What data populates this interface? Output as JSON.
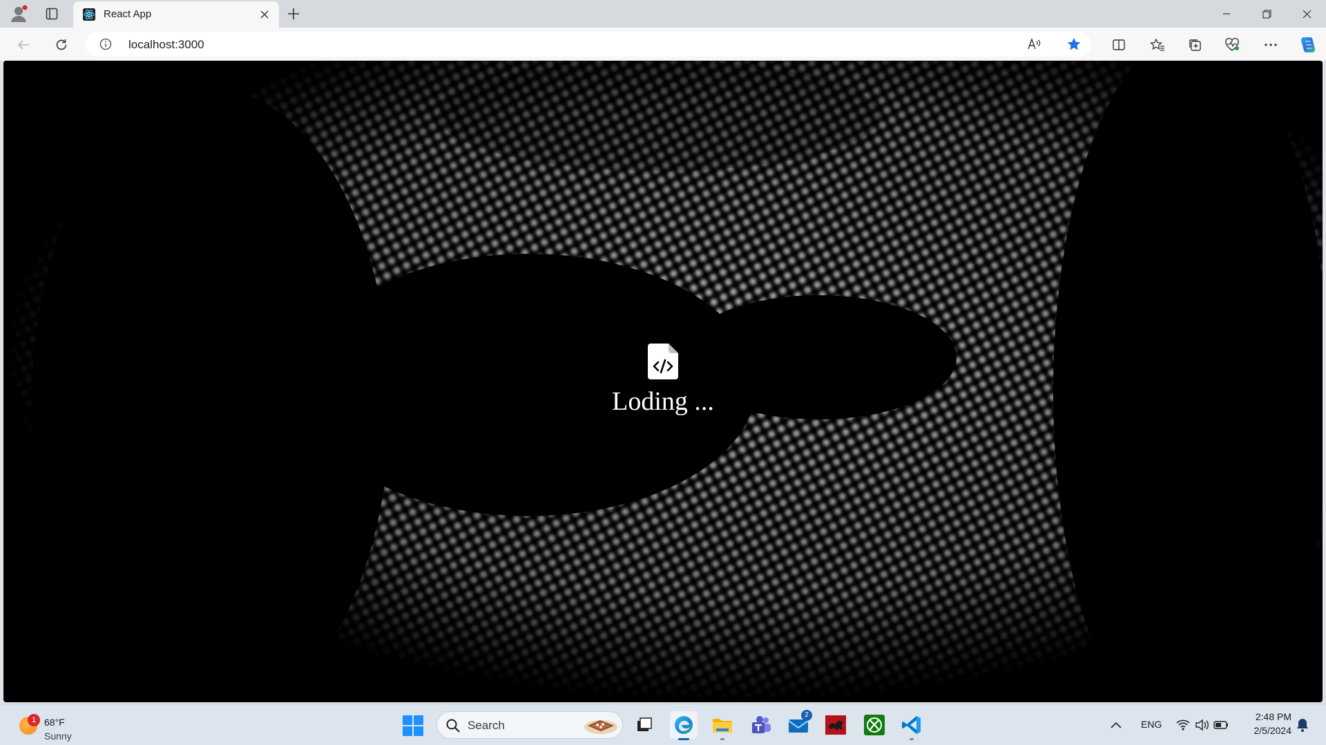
{
  "browser": {
    "tab": {
      "title": "React App",
      "favicon": "react-icon"
    },
    "address": {
      "url": "localhost:3000",
      "info_icon": "info-icon"
    },
    "toolbar_icons": [
      "read-aloud-icon",
      "favorite-star-icon",
      "split-screen-icon",
      "favorites-icon",
      "collections-icon",
      "performance-icon",
      "more-icon",
      "copilot-icon"
    ]
  },
  "page": {
    "loader_icon": "file-code-icon",
    "loader_text": "Loding ..."
  },
  "taskbar": {
    "weather": {
      "badge": "1",
      "temp": "68°F",
      "condition": "Sunny"
    },
    "search": {
      "label": "Search"
    },
    "apps": [
      {
        "name": "task-view",
        "badge": ""
      },
      {
        "name": "edge",
        "badge": ""
      },
      {
        "name": "file-explorer",
        "badge": ""
      },
      {
        "name": "teams",
        "badge": ""
      },
      {
        "name": "mail",
        "badge": "2"
      },
      {
        "name": "game",
        "badge": ""
      },
      {
        "name": "xbox",
        "badge": ""
      },
      {
        "name": "vscode",
        "badge": ""
      }
    ],
    "tray": {
      "language": "ENG",
      "time": "2:48 PM",
      "date": "2/5/2024"
    }
  },
  "colors": {
    "accent": "#0067c0",
    "page_bg": "#000000",
    "fav_star": "#1a73e8"
  }
}
